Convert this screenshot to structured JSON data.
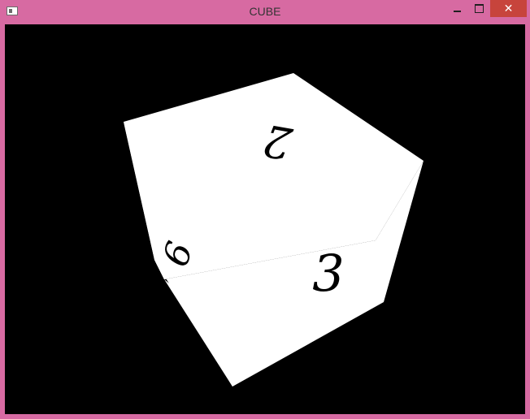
{
  "window": {
    "title": "CUBE",
    "minimize_label": "",
    "close_label": "✕"
  },
  "cube": {
    "top_face_number": "2",
    "front_face_number": "3",
    "side_face_number": "6",
    "face_color": "#ffffff",
    "background_color": "#000000"
  },
  "colors": {
    "frame": "#d76aa2",
    "close_button": "#c7443c"
  }
}
